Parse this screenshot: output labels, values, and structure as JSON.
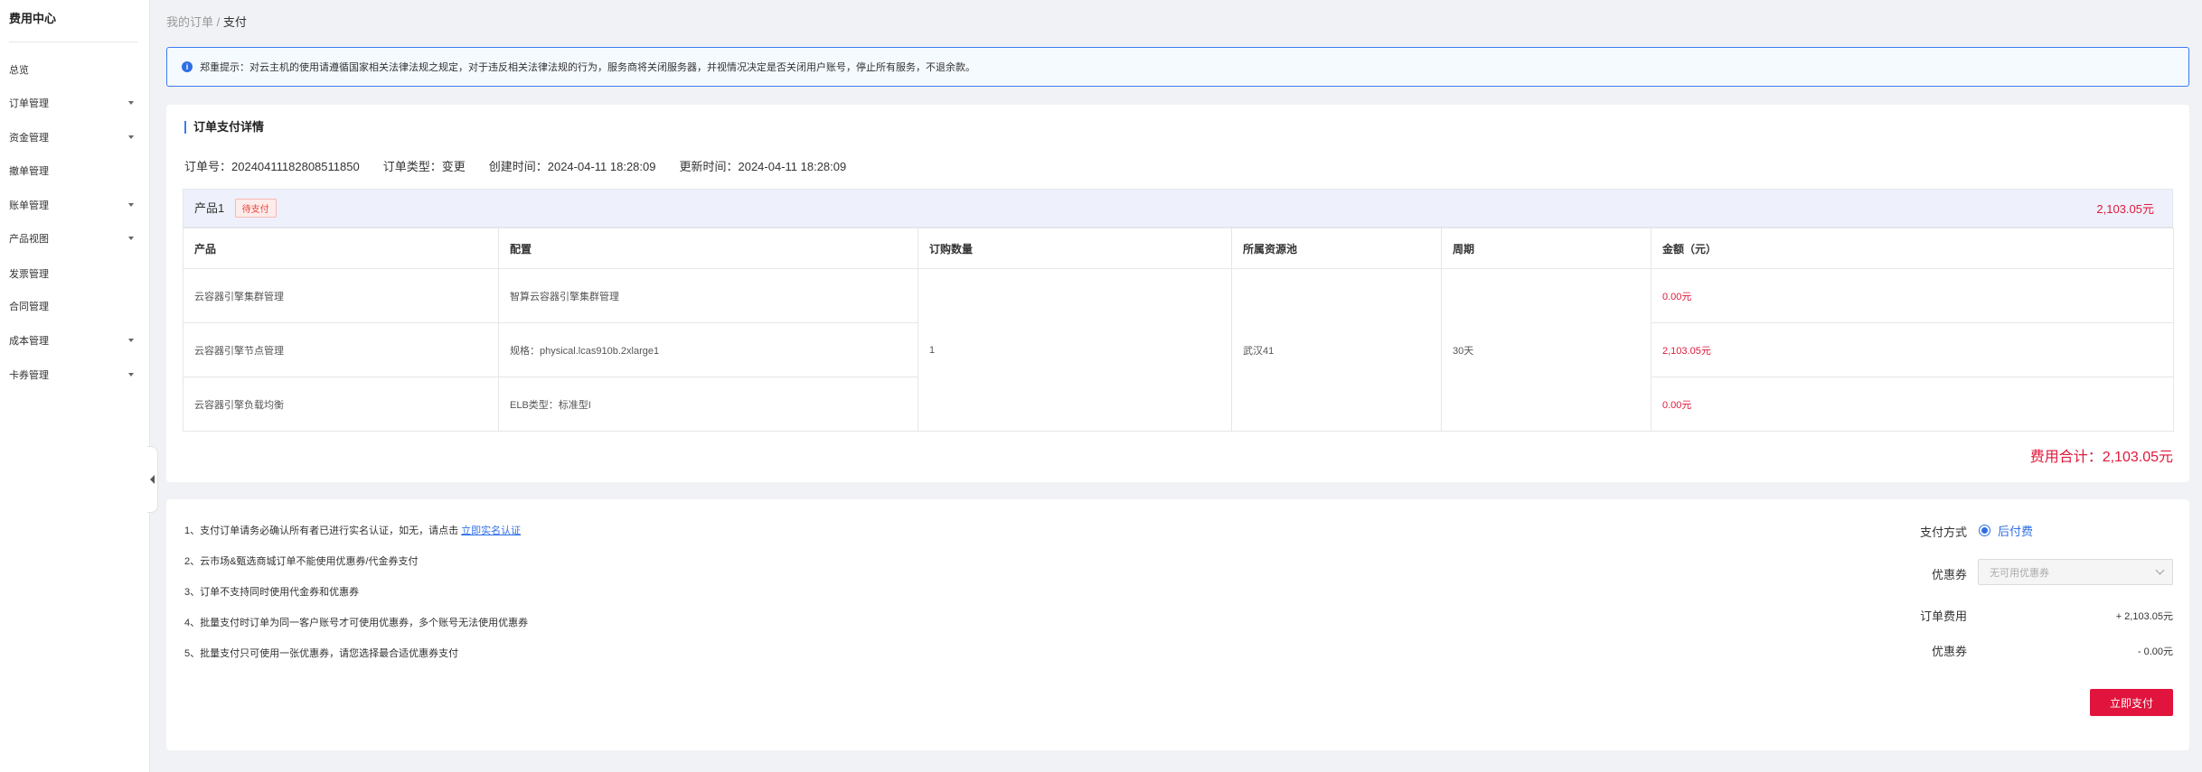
{
  "sidebar": {
    "title": "费用中心",
    "items": [
      {
        "label": "总览",
        "expandable": false
      },
      {
        "label": "订单管理",
        "expandable": true
      },
      {
        "label": "资金管理",
        "expandable": true
      },
      {
        "label": "撤单管理",
        "expandable": false
      },
      {
        "label": "账单管理",
        "expandable": true
      },
      {
        "label": "产品视图",
        "expandable": true
      },
      {
        "label": "发票管理",
        "expandable": false
      },
      {
        "label": "合同管理",
        "expandable": false
      },
      {
        "label": "成本管理",
        "expandable": true
      },
      {
        "label": "卡券管理",
        "expandable": true
      }
    ]
  },
  "breadcrumb": {
    "parent": "我的订单",
    "separator": "/",
    "current": "支付"
  },
  "notice": {
    "icon": "info-icon",
    "text": "郑重提示：对云主机的使用请遵循国家相关法律法规之规定，对于违反相关法律法规的行为，服务商将关闭服务器，并视情况决定是否关闭用户账号，停止所有服务，不退余款。"
  },
  "order": {
    "section_title": "订单支付详情",
    "order_no": "订单号：20240411182808511850",
    "order_type": "订单类型：变更",
    "created": "创建时间：2024-04-11 18:28:09",
    "updated": "更新时间：2024-04-11 18:28:09",
    "product": {
      "name": "产品1",
      "status": "待支付",
      "amount": "2,103.05元"
    },
    "columns": [
      "产品",
      "配置",
      "订购数量",
      "所属资源池",
      "周期",
      "金额（元）"
    ],
    "rows": [
      {
        "product": "云容器引擎集群管理",
        "config": "智算云容器引擎集群管理",
        "amount": "0.00元"
      },
      {
        "product": "云容器引擎节点管理",
        "config": "规格：physical.lcas910b.2xlarge1",
        "amount": "2,103.05元"
      },
      {
        "product": "云容器引擎负载均衡",
        "config": "ELB类型：标准型I",
        "amount": "0.00元"
      }
    ],
    "quantity": "1",
    "resource_pool": "武汉41",
    "period": "30天",
    "total": "费用合计：2,103.05元"
  },
  "payment": {
    "notes": [
      {
        "text": "1、支付订单请务必确认所有者已进行实名认证，如无，请点击 ",
        "link": "立即实名认证"
      },
      {
        "text": "2、云市场&甄选商城订单不能使用优惠券/代金券支付",
        "link": ""
      },
      {
        "text": "3、订单不支持同时使用代金券和优惠券",
        "link": ""
      },
      {
        "text": "4、批量支付时订单为同一客户账号才可使用优惠券，多个账号无法使用优惠券",
        "link": ""
      },
      {
        "text": "5、批量支付只可使用一张优惠券，请您选择最合适优惠券支付",
        "link": ""
      }
    ],
    "method_label": "支付方式",
    "method_option": "后付费",
    "coupon_label": "优惠券",
    "coupon_placeholder": "无可用优惠券",
    "fee_label": "订单费用",
    "fee_value": "+ 2,103.05元",
    "discount_label": "优惠券",
    "discount_value": "- 0.00元",
    "pay_button": "立即支付"
  }
}
